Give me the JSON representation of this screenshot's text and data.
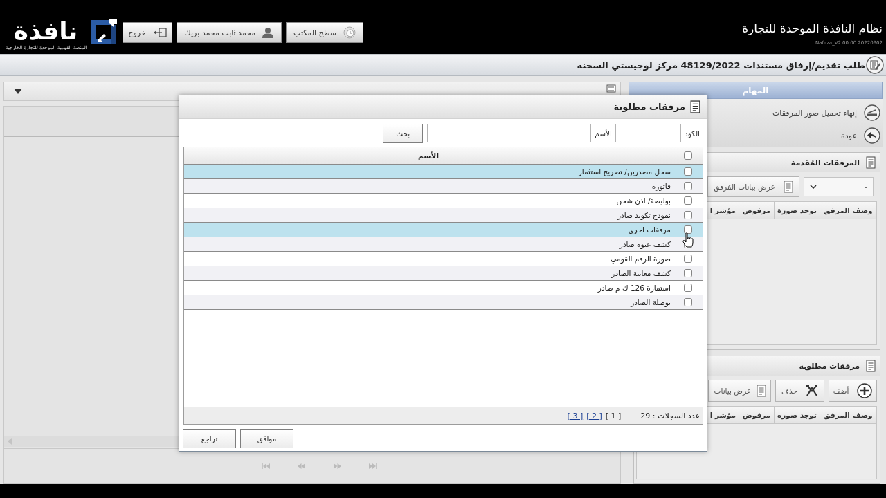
{
  "header": {
    "logo_text": "نافذة",
    "logo_tagline": "المنصة القومية الموحدة للتجارة الخارجية",
    "buttons": [
      {
        "kind": "desktop",
        "label": "سطح المكتب"
      },
      {
        "kind": "user",
        "label": "محمد ثابت محمد بريك"
      },
      {
        "kind": "exit",
        "label": "خروج"
      }
    ],
    "title": "نظام النافذة الموحدة للتجارة",
    "version": "Nafeza_V2.00.00.20220902"
  },
  "breadcrumb": {
    "text": "طلب تقديم/إرفاق مستندات 48129/2022 مركز لوجيستي السخنة"
  },
  "tasks": {
    "title": "المهام",
    "items": [
      {
        "kind": "finish_upload",
        "label": "إنهاء تحميل صور المرفقات"
      },
      {
        "kind": "back",
        "label": "عودة"
      }
    ]
  },
  "submitted_attachments": {
    "title": "المرفقات المُقدمة",
    "select": {
      "value": "-"
    },
    "buttons": [
      {
        "kind": "view",
        "label": "عرض بيانات المُرفق"
      }
    ],
    "columns": [
      "وصف المرفق",
      "توجد صورة",
      "مرفوض",
      "مؤشر ا"
    ]
  },
  "required_attachments": {
    "title": "مرفقات مطلوبة",
    "buttons": [
      {
        "kind": "add",
        "label": "أضف"
      },
      {
        "kind": "delete",
        "label": "حذف"
      },
      {
        "kind": "view",
        "label": "عرض بيانات"
      }
    ],
    "columns": [
      "وصف المرفق",
      "توجد صورة",
      "مرفوض",
      "مؤشر ا"
    ]
  },
  "dialog": {
    "title": "مرفقات مطلوبة",
    "search": {
      "code_label": "الكود",
      "name_label": "الأسم",
      "button": "بحث"
    },
    "table": {
      "header_checked": false,
      "column": "الأسم",
      "rows": [
        {
          "name": "سجل مصدرين/ تصريح استثمار",
          "checked": false,
          "selected": true
        },
        {
          "name": "فاتورة",
          "checked": false,
          "selected": false
        },
        {
          "name": "بوليصة/ اذن شحن",
          "checked": false,
          "selected": false
        },
        {
          "name": "نموذج تكويد صادر",
          "checked": false,
          "selected": false
        },
        {
          "name": "مرفقات اخرى",
          "checked": false,
          "selected": true
        },
        {
          "name": "كشف عبوة صادر",
          "checked": false,
          "selected": false
        },
        {
          "name": "صورة الرقم القومي",
          "checked": false,
          "selected": false
        },
        {
          "name": "كشف معاينة الصادر",
          "checked": false,
          "selected": false
        },
        {
          "name": "استمارة 126 ك م صادر",
          "checked": false,
          "selected": false
        },
        {
          "name": "بوصلة الصادر",
          "checked": false,
          "selected": false
        }
      ]
    },
    "record_count": "عدد السجلات : 29",
    "pages": [
      {
        "label": "[ 1 ]",
        "selected": true
      },
      {
        "label": "[ 2 ]",
        "selected": false
      },
      {
        "label": "[ 3 ]",
        "selected": false
      }
    ],
    "buttons": [
      "موافق",
      "تراجع"
    ]
  }
}
